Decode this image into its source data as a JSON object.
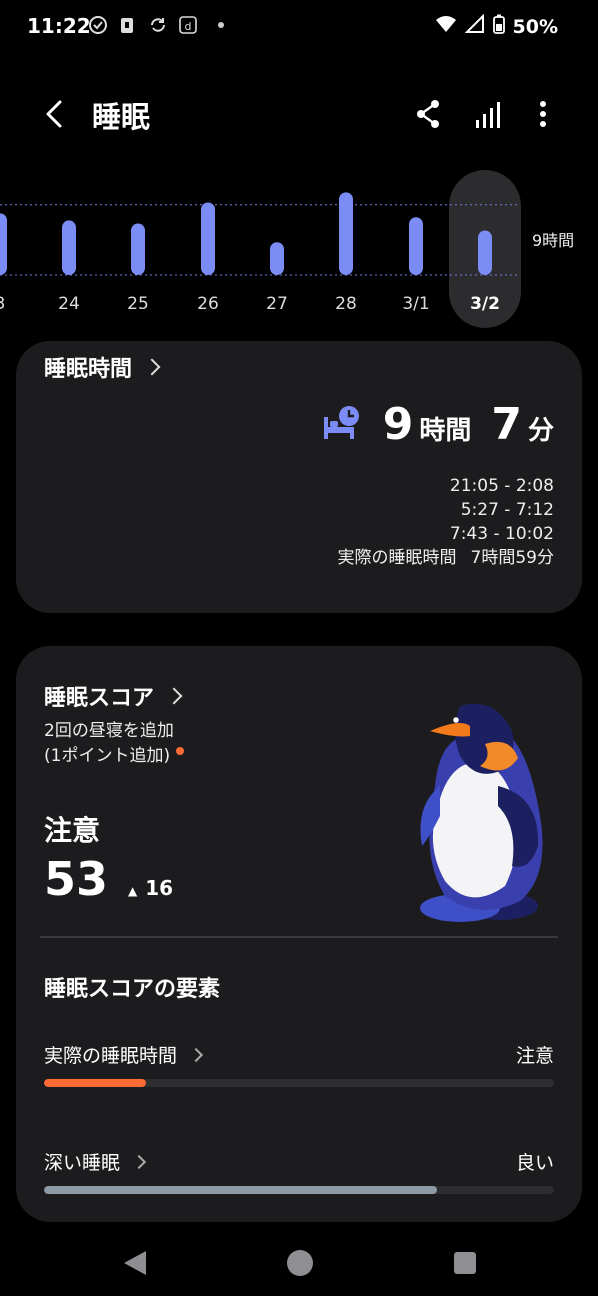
{
  "status_bar": {
    "time": "11:22",
    "battery": "50%",
    "icons": [
      "check-circle-icon",
      "sim-icon",
      "sync-icon",
      "d-icon",
      "dot-icon",
      "wifi-icon",
      "signal-icon",
      "battery-icon"
    ]
  },
  "header": {
    "title": "睡眠",
    "icons": [
      "back-arrow-icon",
      "share-icon",
      "bar-chart-icon",
      "more-vert-icon"
    ]
  },
  "chart_data": {
    "type": "bar",
    "categories": [
      "3",
      "24",
      "25",
      "26",
      "27",
      "28",
      "3/1",
      "3/2"
    ],
    "values": [
      7.9,
      7.0,
      6.6,
      9.3,
      4.2,
      10.6,
      7.4,
      5.7
    ],
    "selected": "3/2",
    "reference_line_label": "9時間",
    "bar_color": "#7b8cf5"
  },
  "sleep_card": {
    "title": "睡眠時間",
    "hours": "9",
    "hours_unit": "時間",
    "minutes": "7",
    "minutes_unit": "分",
    "ranges": [
      "21:05 - 2:08",
      "5:27 - 7:12",
      "7:43 - 10:02"
    ],
    "actual_label": "実際の睡眠時間",
    "actual_value": "7時間59分"
  },
  "score_card": {
    "title": "睡眠スコア",
    "nap_line1": "2回の昼寝を追加",
    "nap_line2": "(1ポイント追加)",
    "status": "注意",
    "score": "53",
    "delta_symbol": "▲",
    "delta": "16",
    "factors_title": "睡眠スコアの要素",
    "factors": [
      {
        "label": "実際の睡眠時間",
        "value": "注意",
        "fraction": 0.2,
        "color": "#ff6b35"
      },
      {
        "label": "深い睡眠",
        "value": "良い",
        "fraction": 0.77,
        "color": "#8e9aa6"
      }
    ]
  },
  "nav": {
    "icons": [
      "back-triangle-icon",
      "home-circle-icon",
      "recents-square-icon"
    ]
  }
}
